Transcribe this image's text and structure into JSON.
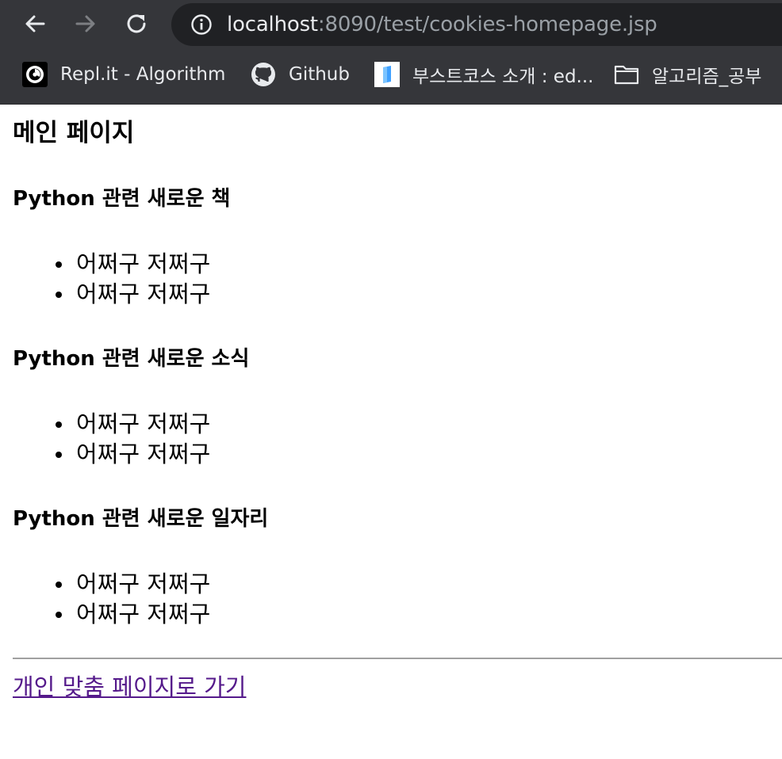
{
  "browser": {
    "url_host": "localhost",
    "url_path": ":8090/test/cookies-homepage.jsp",
    "bookmarks": [
      {
        "label": "Repl.it - Algorithm",
        "icon": "replit-icon"
      },
      {
        "label": "Github",
        "icon": "github-icon"
      },
      {
        "label": "부스트코스 소개 : ed...",
        "icon": "boostcourse-icon"
      },
      {
        "label": "알고리즘_공부",
        "icon": "folder-icon"
      }
    ]
  },
  "page": {
    "title": "메인 페이지",
    "sections": [
      {
        "heading": "Python 관련 새로운 책",
        "items": [
          "어쩌구 저쩌구",
          "어쩌구 저쩌구"
        ]
      },
      {
        "heading": "Python 관련 새로운 소식",
        "items": [
          "어쩌구 저쩌구",
          "어쩌구 저쩌구"
        ]
      },
      {
        "heading": "Python 관련 새로운 일자리",
        "items": [
          "어쩌구 저쩌구",
          "어쩌구 저쩌구"
        ]
      }
    ],
    "link_label": "개인 맞춤 페이지로 가기"
  }
}
